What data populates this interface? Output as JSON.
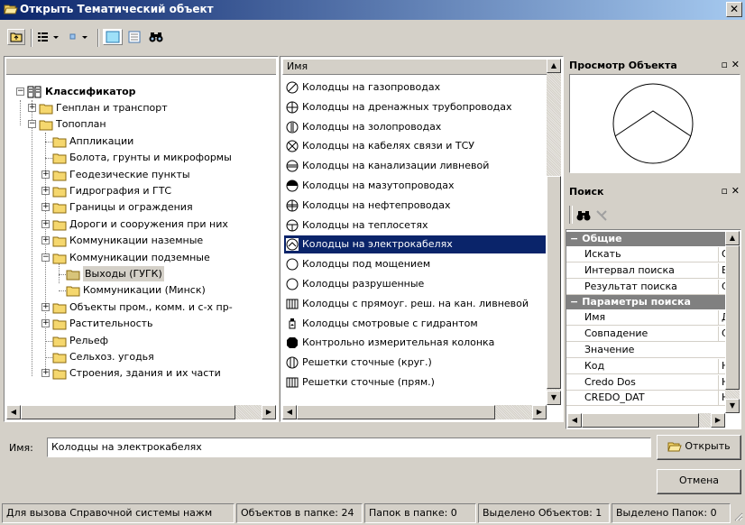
{
  "window": {
    "title": "Открыть Тематический объект",
    "close_glyph": "✕"
  },
  "icons": {
    "title": "open-folder-icon",
    "up": "folder-up-icon",
    "view": "view-mode-icon",
    "small": "small-icons-icon",
    "large": "large-icons-icon",
    "list": "list-view-icon",
    "find": "binoculars-icon"
  },
  "tree": {
    "header": "",
    "root": "Классификатор",
    "items": [
      {
        "label": "Генплан и транспорт",
        "level": 1,
        "expander": "+"
      },
      {
        "label": "Топоплан",
        "level": 1,
        "expander": "−"
      },
      {
        "label": "Аппликации",
        "level": 2,
        "expander": ""
      },
      {
        "label": "Болота, грунты и микроформы",
        "level": 2,
        "expander": ""
      },
      {
        "label": "Геодезические пункты",
        "level": 2,
        "expander": "+"
      },
      {
        "label": "Гидрография и ГТС",
        "level": 2,
        "expander": "+"
      },
      {
        "label": "Границы и ограждения",
        "level": 2,
        "expander": "+"
      },
      {
        "label": "Дороги и сооружения при них",
        "level": 2,
        "expander": "+"
      },
      {
        "label": "Коммуникации наземные",
        "level": 2,
        "expander": "+"
      },
      {
        "label": "Коммуникации подземные",
        "level": 2,
        "expander": "−"
      },
      {
        "label": "Выходы (ГУГК)",
        "level": 3,
        "expander": ""
      },
      {
        "label": "Коммуникации (Минск)",
        "level": 3,
        "expander": ""
      },
      {
        "label": "Объекты пром., комм. и с-х пр-",
        "level": 2,
        "expander": "+"
      },
      {
        "label": "Растительность",
        "level": 2,
        "expander": "+"
      },
      {
        "label": "Рельеф",
        "level": 2,
        "expander": ""
      },
      {
        "label": "Сельхоз. угодья",
        "level": 2,
        "expander": ""
      },
      {
        "label": "Строения, здания и их части",
        "level": 2,
        "expander": "+"
      }
    ]
  },
  "list": {
    "header": "Имя",
    "items": [
      {
        "label": "Колодцы на газопроводах",
        "symbol": "circle-slash"
      },
      {
        "label": "Колодцы на дренажных трубопроводах",
        "symbol": "circle-cross"
      },
      {
        "label": "Колодцы на золопроводах",
        "symbol": "circle-vbar"
      },
      {
        "label": "Колодцы на кабелях связи и ТСУ",
        "symbol": "circle-diag"
      },
      {
        "label": "Колодцы на канализации ливневой",
        "symbol": "circle-hbar"
      },
      {
        "label": "Колодцы на мазутопроводах",
        "symbol": "circle-half"
      },
      {
        "label": "Колодцы на нефтепроводах",
        "symbol": "circle-double"
      },
      {
        "label": "Колодцы на теплосетях",
        "symbol": "circle-t"
      },
      {
        "label": "Колодцы на электрокабелях",
        "symbol": "circle-v",
        "selected": true
      },
      {
        "label": "Колодцы под мощением",
        "symbol": "circle"
      },
      {
        "label": "Колодцы разрушенные",
        "symbol": "circle"
      },
      {
        "label": "Колодцы с прямоуг. реш. на кан. ливневой",
        "symbol": "grate-rect"
      },
      {
        "label": "Колодцы смотровые с гидрантом",
        "symbol": "hydrant"
      },
      {
        "label": "Контрольно измерительная колонка",
        "symbol": "octagon"
      },
      {
        "label": "Решетки сточные (круг.)",
        "symbol": "grate-round"
      },
      {
        "label": "Решетки сточные (прям.)",
        "symbol": "grate-rect"
      }
    ]
  },
  "preview": {
    "title": "Просмотр Объекта",
    "controls": "▫ ✕"
  },
  "search": {
    "title": "Поиск",
    "controls": "▫ ✕",
    "groups": [
      {
        "label": "Общие",
        "rows": [
          {
            "name": "Искать",
            "value": "О"
          },
          {
            "name": "Интервал поиска",
            "value": "В"
          },
          {
            "name": "Результат поиска",
            "value": "С"
          }
        ]
      },
      {
        "label": "Параметры поиска",
        "rows": [
          {
            "name": "Имя",
            "value": "Д"
          },
          {
            "name": "Совпадение",
            "value": "С"
          },
          {
            "name": "Значение",
            "value": ""
          },
          {
            "name": "Код",
            "value": "Н"
          },
          {
            "name": "Credo Dos",
            "value": "Н"
          },
          {
            "name": "CREDO_DAT",
            "value": "Н"
          }
        ]
      }
    ],
    "collapse_glyph": "−"
  },
  "name_field": {
    "label": "Имя:",
    "value": "Колодцы на электрокабелях"
  },
  "buttons": {
    "open": "Открыть",
    "cancel": "Отмена"
  },
  "status": {
    "help": "Для вызова Справочной системы нажм",
    "objects": "Объектов в папке: 24",
    "folders": "Папок в папке: 0",
    "sel_objects": "Выделено Объектов: 1",
    "sel_folders": "Выделено Папок: 0"
  },
  "colors": {
    "selection": "#0a246a",
    "folder": "#f5d76e",
    "face": "#d4d0c8"
  }
}
